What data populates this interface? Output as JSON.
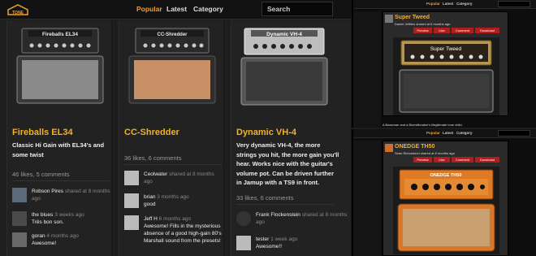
{
  "app": {
    "logo_text": "TONE",
    "nav": [
      "Popular",
      "Latest",
      "Category"
    ],
    "search_placeholder": "Search"
  },
  "columns": [
    {
      "amp_plate": "Fireballs EL34",
      "name": "Fireballs EL34",
      "description": "Classic Hi Gain with EL34's and some twist",
      "stats": "46 likes, 5 comments",
      "comments": [
        {
          "user": "Robson Pires",
          "meta": " shared at 8 months ago",
          "text": ""
        },
        {
          "user": "the blues",
          "meta": " 3 weeks ago",
          "text": "Três bon son."
        },
        {
          "user": "goran",
          "meta": " 4 months ago",
          "text": "Awesome!"
        }
      ],
      "colors": {
        "grill": "#8a8a8a",
        "head": "#2a2a2a"
      }
    },
    {
      "amp_plate": "CC-Shredder",
      "name": "CC-Shredder",
      "description": "",
      "stats": "36 likes, 6 comments",
      "comments": [
        {
          "user": "Ceolwater",
          "meta": " shared at 8 months ago",
          "text": ""
        },
        {
          "user": "brian",
          "meta": " 3 months ago",
          "text": "good"
        },
        {
          "user": "Jeff H",
          "meta": " 6 months ago",
          "text": "Awesome! Fills in the mysterious absence of a good high-gain 80's Marshall sound from the presets!"
        }
      ],
      "colors": {
        "grill": "#c98f66",
        "head": "#2a2a2a"
      }
    },
    {
      "amp_plate": "Dynamic VH-4",
      "name": "Dynamic VH-4",
      "description": "Very dynamic VH-4, the more strings you hit, the more gain you'll hear. Works nice with the guitar's volume pot. Can be driven further in Jamup with a TS9 in front.",
      "stats": "33 likes, 6 comments",
      "comments": [
        {
          "user": "Frank Flockenstein",
          "meta": " shared at 8 months ago",
          "text": ""
        },
        {
          "user": "tester",
          "meta": " 1 week ago",
          "text": "Awesome!!"
        }
      ],
      "colors": {
        "grill": "#3a3a3a",
        "head": "#bdbdbd"
      }
    }
  ],
  "side_panels": [
    {
      "nav": [
        "Popular",
        "Latest",
        "Category"
      ],
      "title": "Super Tweed",
      "subtitle": "Daniel Jeffries shared at 6 months ago",
      "buttons": [
        "Preview",
        "Like",
        "Comment",
        "Download"
      ],
      "amp_plate": "Super Tweed",
      "caption": "A Bassman and a BluesBreaker's illegitimate tone child."
    },
    {
      "nav": [
        "Popular",
        "Latest",
        "Category"
      ],
      "title": "ONEDGE TH50",
      "subtitle": "Sean Richardson shared at 8 months ago",
      "buttons": [
        "Preview",
        "Like",
        "Comment",
        "Download"
      ],
      "amp_plate": "ONEDGE TH50",
      "caption": ""
    }
  ]
}
